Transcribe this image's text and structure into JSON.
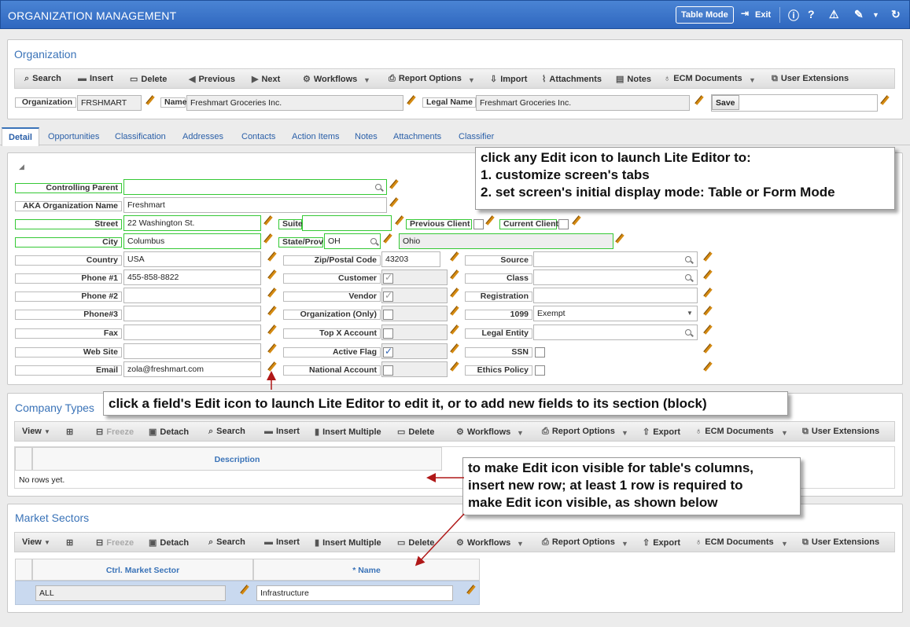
{
  "header": {
    "title": "ORGANIZATION MANAGEMENT",
    "table_mode": "Table Mode",
    "exit": "Exit"
  },
  "org": {
    "title": "Organization",
    "toolbar": {
      "search": "Search",
      "insert": "Insert",
      "delete": "Delete",
      "previous": "Previous",
      "next": "Next",
      "workflows": "Workflows",
      "report_options": "Report Options",
      "import": "Import",
      "attachments": "Attachments",
      "notes": "Notes",
      "ecm": "ECM Documents",
      "user_ext": "User Extensions"
    },
    "org_label": "Organization",
    "org_value": "FRSHMART",
    "name_label": "Name",
    "name_value": "Freshmart Groceries Inc.",
    "legal_label": "Legal Name",
    "legal_value": "Freshmart Groceries Inc.",
    "save": "Save"
  },
  "tabs": [
    "Detail",
    "Opportunities",
    "Classification",
    "Addresses",
    "Contacts",
    "Action Items",
    "Notes",
    "Attachments",
    "Classifier"
  ],
  "detail": {
    "controlling_parent": "Controlling Parent",
    "aka": "AKA Organization Name",
    "aka_value": "Freshmart",
    "street": "Street",
    "street_value": "22 Washington St.",
    "suite": "Suite",
    "previous_client": "Previous Client",
    "current_client": "Current Client",
    "city": "City",
    "city_value": "Columbus",
    "state": "State/Prov",
    "state_value": "OH",
    "state_name": "Ohio",
    "country": "Country",
    "country_value": "USA",
    "zip": "Zip/Postal Code",
    "zip_value": "43203",
    "source": "Source",
    "phone1": "Phone #1",
    "phone1_value": "455-858-8822",
    "customer": "Customer",
    "class": "Class",
    "phone2": "Phone #2",
    "vendor": "Vendor",
    "registration": "Registration",
    "phone3": "Phone#3",
    "org_only": "Organization (Only)",
    "n1099": "1099",
    "n1099_value": "Exempt",
    "fax": "Fax",
    "topx": "Top X Account",
    "legal_entity": "Legal Entity",
    "website": "Web Site",
    "active": "Active Flag",
    "ssn": "SSN",
    "email": "Email",
    "email_value": "zola@freshmart.com",
    "national": "National Account",
    "ethics": "Ethics Policy"
  },
  "company_types": {
    "title": "Company Types",
    "toolbar": {
      "view": "View",
      "freeze": "Freeze",
      "detach": "Detach",
      "search": "Search",
      "insert": "Insert",
      "insert_multiple": "Insert Multiple",
      "delete": "Delete",
      "workflows": "Workflows",
      "report_options": "Report Options",
      "export": "Export",
      "ecm": "ECM Documents",
      "user_ext": "User Extensions"
    },
    "col_description": "Description",
    "empty": "No rows yet."
  },
  "market_sectors": {
    "title": "Market Sectors",
    "toolbar": {
      "view": "View",
      "freeze": "Freeze",
      "detach": "Detach",
      "search": "Search",
      "insert": "Insert",
      "insert_multiple": "Insert Multiple",
      "delete": "Delete",
      "workflows": "Workflows",
      "report_options": "Report Options",
      "export": "Export",
      "ecm": "ECM Documents",
      "user_ext": "User Extensions"
    },
    "col_ctrl": "Ctrl. Market Sector",
    "col_name": "* Name",
    "row_ctrl": "ALL",
    "row_name": "Infrastructure"
  },
  "callouts": {
    "c1_line1": "click any Edit icon to launch Lite Editor to:",
    "c1_line2": "1. customize screen's tabs",
    "c1_line3": "2. set screen's initial display mode: Table or Form Mode",
    "c2": "click a field's Edit icon to launch Lite Editor to edit it, or to add new fields to its section (block)",
    "c3_line1": "to make Edit icon visible for table's columns,",
    "c3_line2": "insert new row; at least 1 row is required to",
    "c3_line3": "make Edit icon visible, as shown below"
  }
}
